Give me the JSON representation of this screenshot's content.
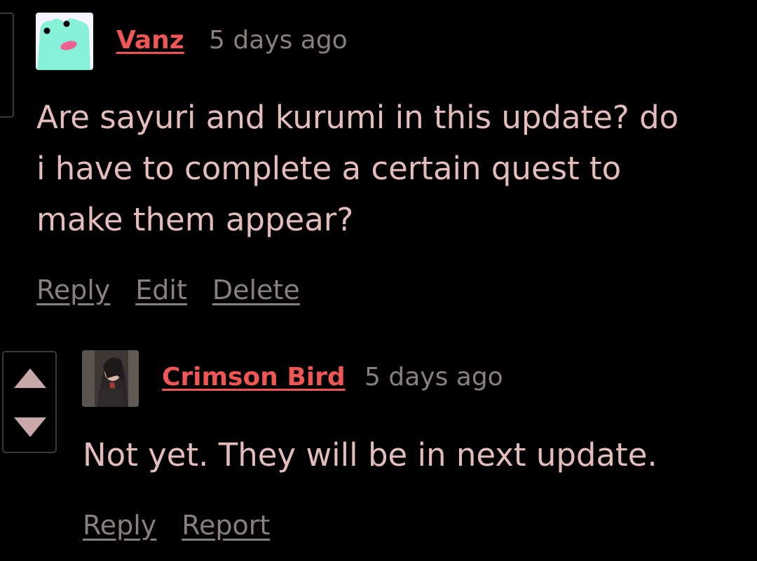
{
  "comments": [
    {
      "author": "Vanz",
      "time": "5 days ago",
      "body_lines": [
        "Are sayuri and kurumi in this update? do",
        "i have to complete a certain quest to",
        "make them appear?"
      ],
      "actions": [
        "Reply",
        "Edit",
        "Delete"
      ]
    },
    {
      "author": "Crimson Bird",
      "time": "5 days ago",
      "body": "Not yet. They will be in next update.",
      "actions": [
        "Reply",
        "Report"
      ]
    }
  ],
  "icons": {
    "upvote": "upvote-arrow-icon",
    "downvote": "downvote-arrow-icon"
  },
  "colors": {
    "author": "#ef5656",
    "body": "#e3bcbc",
    "meta": "#8a7f7f",
    "background": "#000000"
  }
}
